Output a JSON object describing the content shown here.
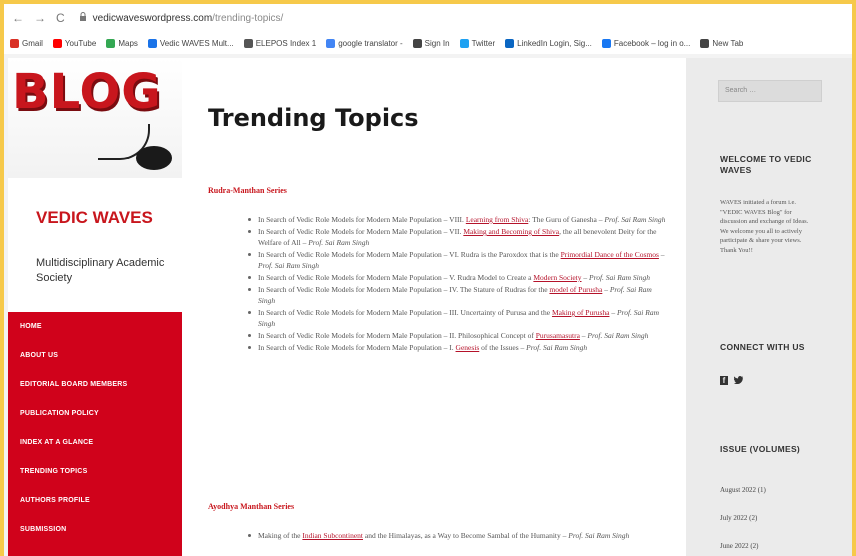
{
  "browser": {
    "nav": [
      "←",
      "→",
      "C"
    ],
    "url_domain": "vedicwaveswordpress.com",
    "url_path": "/trending-topics/"
  },
  "bookmarks": [
    {
      "label": "Gmail",
      "color": "#d93025"
    },
    {
      "label": "YouTube",
      "color": "#ff0000"
    },
    {
      "label": "Maps",
      "color": "#34a853"
    },
    {
      "label": "Vedic WAVES Mult...",
      "color": "#1a73e8"
    },
    {
      "label": "ELEPOS Index 1",
      "color": "#555555"
    },
    {
      "label": "google translator -",
      "color": "#4285f4"
    },
    {
      "label": "Sign In",
      "color": "#444444"
    },
    {
      "label": "Twitter",
      "color": "#1da1f2"
    },
    {
      "label": "LinkedIn Login, Sig...",
      "color": "#0a66c2"
    },
    {
      "label": "Facebook – log in o...",
      "color": "#1877f2"
    },
    {
      "label": "New Tab",
      "color": "#444444"
    }
  ],
  "left_sidebar": {
    "logo_text": "BLOG",
    "site_title": "VEDIC WAVES",
    "site_description": "Multidisciplinary Academic Society",
    "menu": [
      "HOME",
      "ABOUT US",
      "EDITORIAL BOARD MEMBERS",
      "PUBLICATION POLICY",
      "INDEX AT A GLANCE",
      "TRENDING TOPICS",
      "AUTHORS PROFILE",
      "SUBMISSION"
    ]
  },
  "content": {
    "title": "Trending Topics",
    "sections": [
      {
        "heading": "Rudra-Manthan Series",
        "items": [
          {
            "pre": "In Search of Vedic Role Models for Modern Male Population – VIII. ",
            "link": "Learning from Shiva",
            "post": ": The Guru of Ganesha – ",
            "author": "Prof. Sai Ram Singh"
          },
          {
            "pre": "In Search of Vedic Role Models for Modern Male Population – VII. ",
            "link": "Making and Becoming of Shiva",
            "post": ", the all benevolent Deity for the Welfare of All – ",
            "author": "Prof. Sai Ram Singh"
          },
          {
            "pre": "In Search of Vedic Role Models for Modern Male Population – VI. Rudra is the Paroxdox that is the ",
            "link": "Primordial Dance of the Cosmos",
            "post": " – ",
            "author": "Prof. Sai Ram Singh"
          },
          {
            "pre": "In Search of Vedic Role Models for Modern Male Population – V. Rudra Model to Create a ",
            "link": "Modern Society",
            "post": " – ",
            "author": "Prof. Sai Ram Singh"
          },
          {
            "pre": "In Search of Vedic Role Models for Modern Male Population – IV. The Stature of Rudras for the ",
            "link": "model of Purusha",
            "post": " – ",
            "author": "Prof. Sai Ram Singh"
          },
          {
            "pre": "In Search of Vedic Role Models for Modern Male Population – III. Uncertainty of Purusa and the ",
            "link": "Making of Purusha",
            "post": " – ",
            "author": "Prof. Sai Ram Singh"
          },
          {
            "pre": "In Search of Vedic Role Models for Modern Male Population – II. Philosophical Concept of ",
            "link": "Purusamasutra",
            "post": " – ",
            "author": "Prof. Sai Ram Singh"
          },
          {
            "pre": "In Search of Vedic Role Models for Modern Male Population – I. ",
            "link": "Genesis",
            "post": " of the Issues – ",
            "author": "Prof. Sai Ram Singh"
          }
        ]
      },
      {
        "heading": "Ayodhya Manthan Series",
        "items": [
          {
            "pre": "Making of the ",
            "link": "Indian Subcontinent",
            "post": " and the Himalayas, as a Way to Become Sambal of the Humanity – ",
            "author": "Prof. Sai Ram Singh"
          }
        ]
      }
    ]
  },
  "right_sidebar": {
    "search_placeholder": "Search …",
    "welcome_heading": "WELCOME TO VEDIC WAVES",
    "welcome_text": "WAVES initiated a forum i.e. \"VEDIC WAVES Blog\" for discussion and exchange of Ideas. We welcome you all to actively participate & share your views. Thank You!!",
    "connect_heading": "CONNECT WITH US",
    "social_icons": [
      "facebook-icon",
      "twitter-icon"
    ],
    "issue_heading": "ISSUE (VOLUMES)",
    "archives": [
      "August 2022 (1)",
      "July 2022 (2)",
      "June 2022 (2)"
    ]
  }
}
